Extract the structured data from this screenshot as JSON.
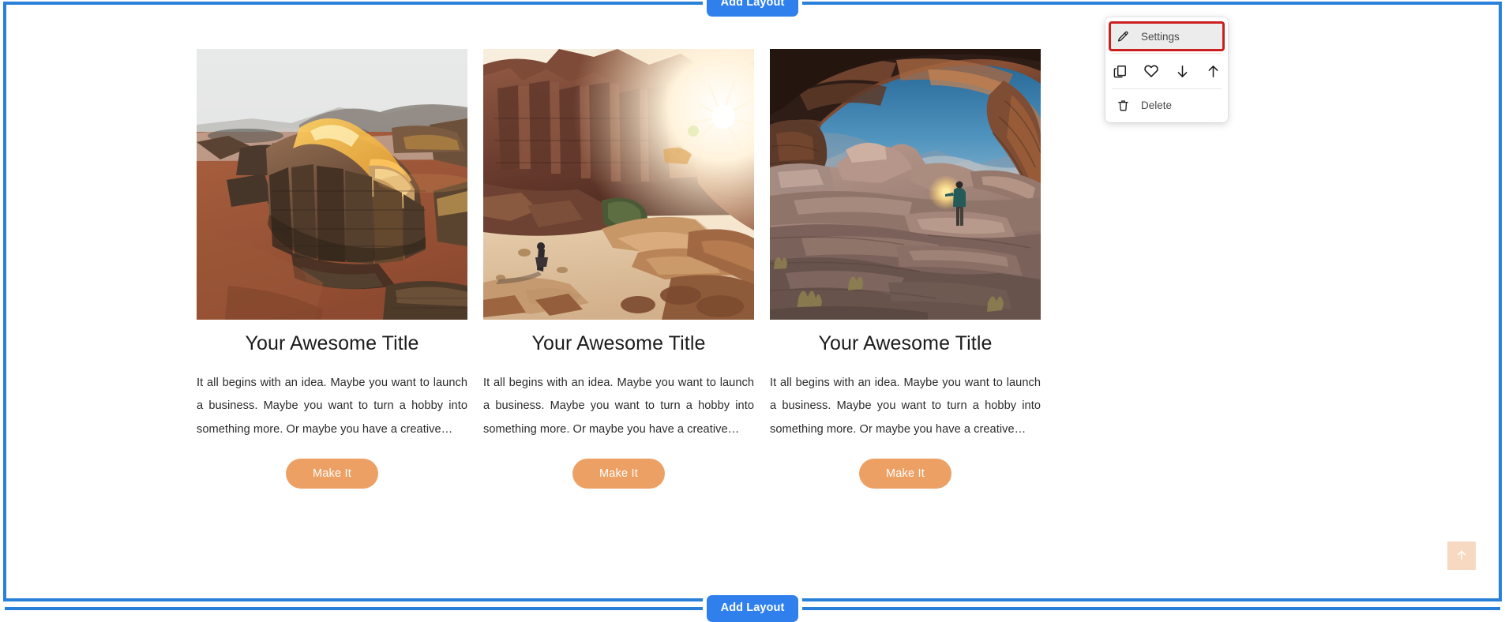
{
  "editor": {
    "add_layout_top_label": "Add Layout",
    "add_layout_bottom_label": "Add Layout",
    "selection_color": "#2980d9",
    "add_layout_color": "#2f80ed"
  },
  "block_menu": {
    "settings_label": "Settings",
    "delete_label": "Delete",
    "highlight_color": "#cc1f1f",
    "icons": [
      {
        "name": "duplicate-icon",
        "title": "Duplicate"
      },
      {
        "name": "heart-icon",
        "title": "Save to favorites"
      },
      {
        "name": "arrow-down-icon",
        "title": "Move down"
      },
      {
        "name": "arrow-up-icon",
        "title": "Move up"
      }
    ]
  },
  "scroll_top": {
    "label": "Back to top",
    "icon": "arrow-up-icon",
    "background": "#f7d9c2"
  },
  "cards": [
    {
      "image_alt": "Aerial view of golden sunlit sandstone rock formations on red desert sand",
      "title": "Your Awesome Title",
      "body": "It all begins with an idea. Maybe you want to launch a business. Maybe you want to turn a hobby into something more. Or maybe you have a creative…",
      "cta_label": "Make It"
    },
    {
      "image_alt": "Lone hiker walking through a red rock canyon with sun flare above the cliffs",
      "title": "Your Awesome Title",
      "body": "It all begins with an idea. Maybe you want to launch a business. Maybe you want to turn a hobby into something more. Or maybe you have a creative…",
      "cta_label": "Make It"
    },
    {
      "image_alt": "Person with a lantern standing under a huge natural rock arch at twilight",
      "title": "Your Awesome Title",
      "body": "It all begins with an idea. Maybe you want to launch a business. Maybe you want to turn a hobby into something more. Or maybe you have a creative…",
      "cta_label": "Make It"
    }
  ],
  "theme": {
    "cta_color": "#eda063",
    "title_color": "#1c1c1c",
    "body_color": "#2b2b2b"
  }
}
